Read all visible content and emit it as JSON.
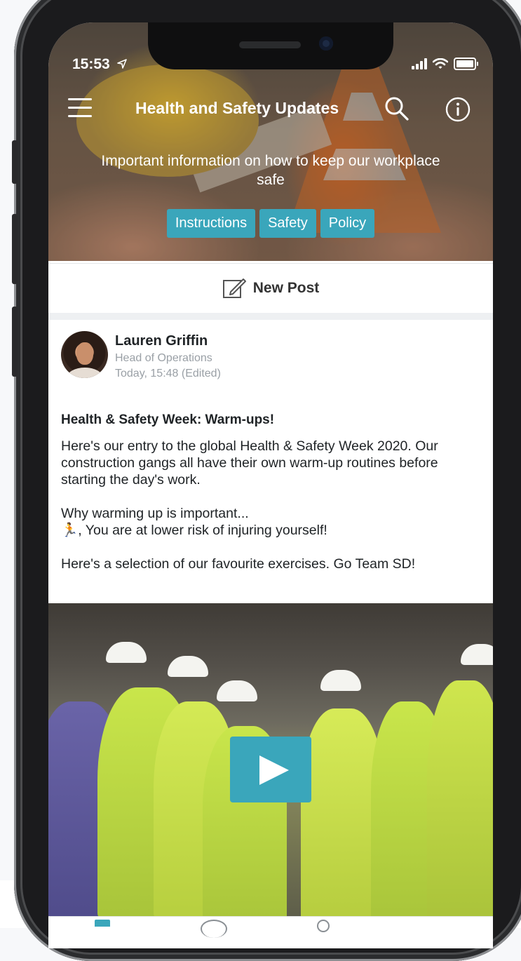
{
  "status_bar": {
    "time": "15:53",
    "location_icon": "location-arrow-icon",
    "signal_icon": "signal-bars-icon",
    "wifi_icon": "wifi-icon",
    "battery_icon": "battery-icon"
  },
  "header": {
    "title": "Health and Safety Updates",
    "subtitle": "Important information on how to keep our workplace safe",
    "tags": [
      "Instructions",
      "Safety",
      "Policy"
    ],
    "menu_icon": "hamburger-menu-icon",
    "search_icon": "search-icon",
    "info_icon": "info-icon",
    "accent_color": "#3aa6bb"
  },
  "new_post": {
    "label": "New Post",
    "icon": "compose-icon"
  },
  "post": {
    "author_name": "Lauren Griffin",
    "author_role": "Head of Operations",
    "timestamp": "Today, 15:48 (Edited)",
    "title": "Health & Safety Week: Warm-ups!",
    "body": {
      "para1": "Here's our entry to the global Health & Safety Week 2020. Our construction gangs all have their own warm-up routines before starting the day's work.",
      "para2_line1": "Why warming up is important...",
      "para2_emoji": "🏃",
      "para2_line2": ", You are at lower risk of injuring yourself!",
      "para3": "Here's a selection of our favourite exercises. Go Team SD!"
    },
    "video": {
      "play_icon": "play-icon"
    }
  }
}
